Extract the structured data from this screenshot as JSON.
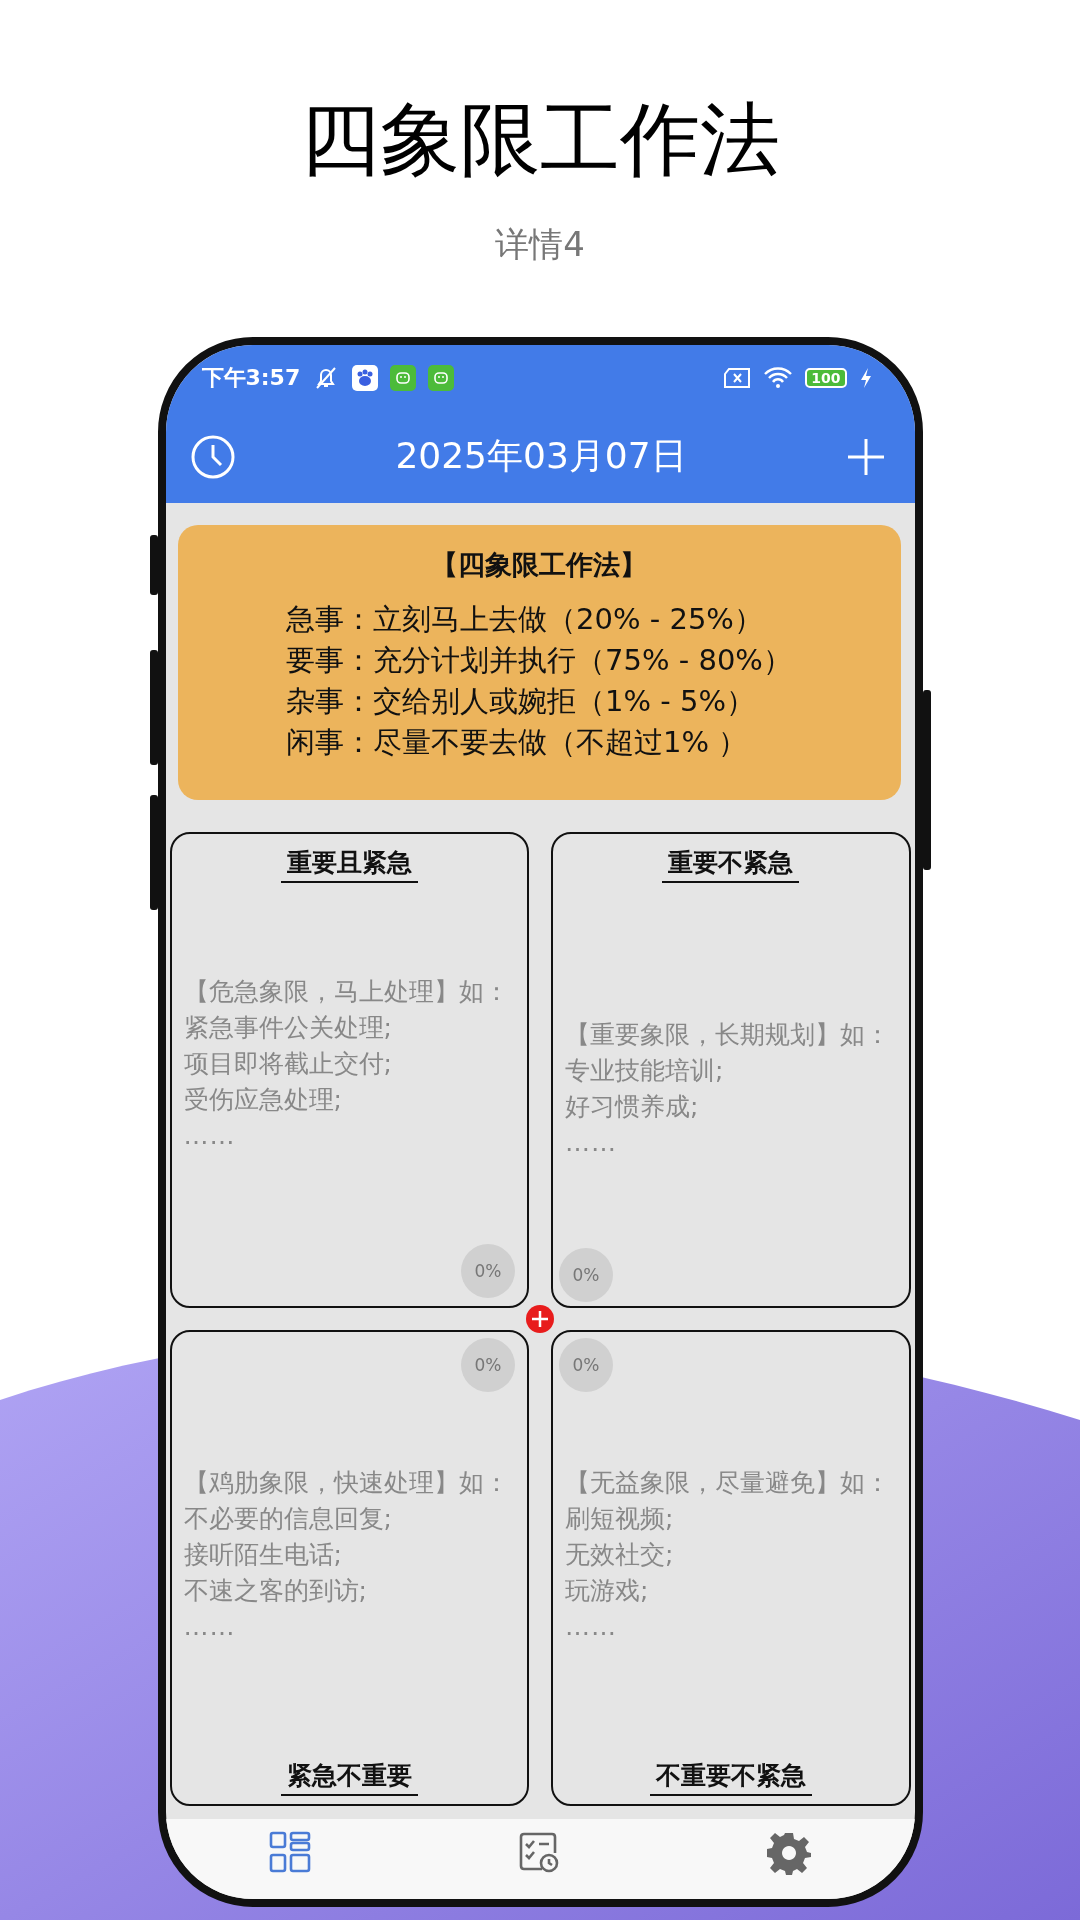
{
  "header": {
    "title": "四象限工作法",
    "subtitle": "详情4"
  },
  "status_bar": {
    "time": "下午3:57",
    "battery": "100"
  },
  "app_bar": {
    "date": "2025年03月07日"
  },
  "method_card": {
    "title": "【四象限工作法】",
    "lines": [
      "急事：立刻马上去做（20% - 25%）",
      "要事：充分计划并执行（75% - 80%）",
      "杂事：交给别人或婉拒（1% - 5%）",
      "闲事：尽量不要去做（不超过1% ）"
    ]
  },
  "quadrants": [
    {
      "kind": "upper",
      "title": "重要且紧急",
      "intro": "【危急象限，马上处理】如：",
      "items": [
        "紧急事件公关处理;",
        "项目即将截止交付;",
        "受伤应急处理;"
      ],
      "ellipsis": "……",
      "progress": "0%"
    },
    {
      "kind": "upper",
      "title": "重要不紧急",
      "intro": "【重要象限，长期规划】如：",
      "items": [
        "专业技能培训;",
        "好习惯养成;"
      ],
      "ellipsis": "……",
      "progress": "0%"
    },
    {
      "kind": "lower",
      "title": "紧急不重要",
      "intro": "【鸡肋象限，快速处理】如：",
      "items": [
        "不必要的信息回复;",
        "接听陌生电话;",
        "不速之客的到访;"
      ],
      "ellipsis": "……",
      "progress": "0%"
    },
    {
      "kind": "lower",
      "title": "不重要不紧急",
      "intro": "【无益象限，尽量避免】如：",
      "items": [
        "刷短视频;",
        "无效社交;",
        "玩游戏;"
      ],
      "ellipsis": "……",
      "progress": "0%"
    }
  ],
  "bottom_nav": [
    {
      "kind": "grid",
      "selected": true
    },
    {
      "kind": "tasks",
      "selected": false
    },
    {
      "kind": "settings",
      "selected": false
    }
  ]
}
